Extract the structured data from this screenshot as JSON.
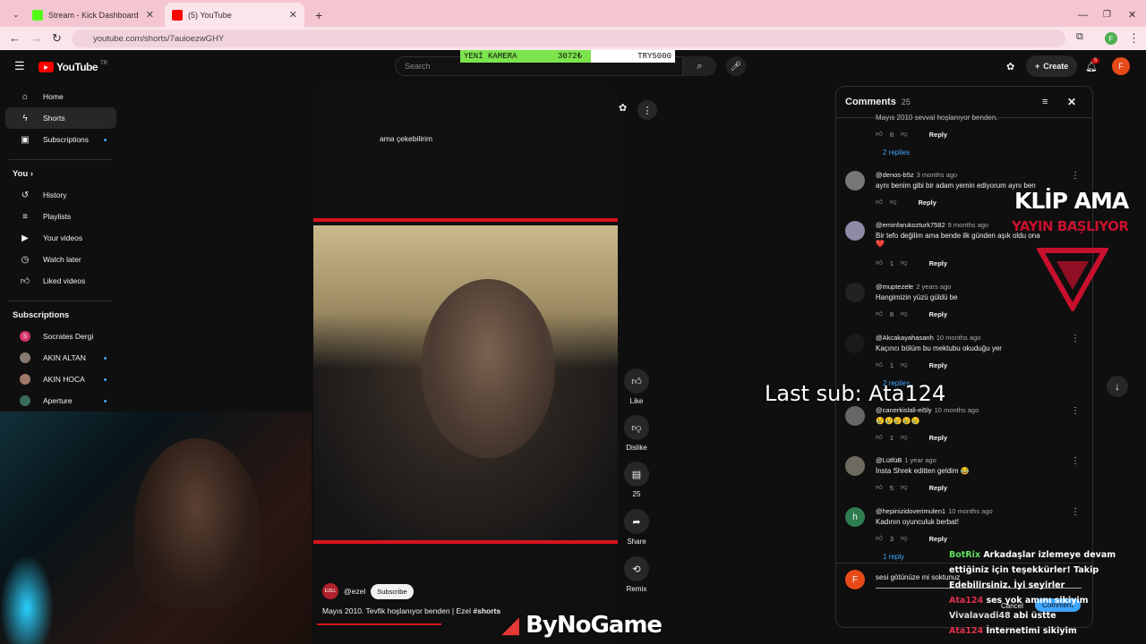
{
  "browser": {
    "tabs": [
      {
        "title": "Stream - Kick Dashboard",
        "favicon_color": "#53fc18"
      },
      {
        "title": "(5) YouTube",
        "favicon_color": "#ff0000"
      }
    ],
    "url": "youtube.com/shorts/7auioezwGHY",
    "new_tab_symbol": "+",
    "profile_initial": "F"
  },
  "youtube": {
    "logo_text": "YouTube",
    "logo_region": "TR",
    "search_placeholder": "Search",
    "create_label": "Create",
    "notifications_count": "5",
    "avatar_initial": "F"
  },
  "stream_overlay": {
    "camera_label": "YENİ KAMERA",
    "camera_amount": "3072₺",
    "target": "TRY5000",
    "last_sub": "Last sub: Ata124",
    "promo_line1": "KLİP AMA",
    "promo_line2": "YAYIN BAŞLIYOR",
    "watermark": "ByNoGame"
  },
  "sidebar": {
    "main": [
      {
        "label": "Home",
        "icon": "home-icon"
      },
      {
        "label": "Shorts",
        "icon": "shorts-icon",
        "selected": true
      },
      {
        "label": "Subscriptions",
        "icon": "subscriptions-icon"
      }
    ],
    "you_heading": "You",
    "you_items": [
      {
        "label": "History",
        "icon": "history-icon"
      },
      {
        "label": "Playlists",
        "icon": "playlists-icon"
      },
      {
        "label": "Your videos",
        "icon": "your-videos-icon"
      },
      {
        "label": "Watch later",
        "icon": "watch-later-icon"
      },
      {
        "label": "Liked videos",
        "icon": "liked-icon"
      }
    ],
    "subs_heading": "Subscriptions",
    "subs": [
      {
        "label": "Socrates Dergi",
        "color": "#d6336c"
      },
      {
        "label": "AKIN ALTAN",
        "color": "#8a7a70"
      },
      {
        "label": "AKIN HOCA",
        "color": "#a07868"
      },
      {
        "label": "Aperture",
        "color": "#3a6a5a"
      }
    ]
  },
  "video": {
    "caption": "ama çekebilirim",
    "channel": "@ezel",
    "channel_badge": "EZEL",
    "subscribe": "Subscribe",
    "title": "Mayıs 2010. Tevfik hoşlanıyor benden | Ezel ",
    "hashtag": "#shorts",
    "progress": 0.41
  },
  "actions": {
    "like": "Like",
    "dislike": "Dislike",
    "comments": "25",
    "share": "Share",
    "remix": "Remix"
  },
  "comments": {
    "title": "Comments",
    "count": "25",
    "reply_label": "Reply",
    "items": [
      {
        "user": "",
        "when": "",
        "text": "Mayıs 2010 sevval hoşlanıyor benden.",
        "likes": "8",
        "replies": "2 replies"
      },
      {
        "user": "@denos-b5z",
        "when": "3 months ago",
        "text": "aynı benim gibi bir adam yemin ediyorum aynı ben",
        "likes": "",
        "replies": ""
      },
      {
        "user": "@eminfarukozturk7582",
        "when": "9 months ago",
        "text": "Bir tefo değilim ama bende ilk günden aşık oldu ona",
        "extra": "❤️",
        "likes": "1",
        "replies": ""
      },
      {
        "user": "@muptezele",
        "when": "2 years ago",
        "text": "Hangimizin yüzü güldü be",
        "likes": "8",
        "replies": ""
      },
      {
        "user": "@Akcakayahasanh",
        "when": "10 months ago",
        "text": "Kaçıncı bölüm bu mektubu okuduğu yer",
        "likes": "1",
        "replies": "2 replies"
      },
      {
        "user": "@canerkislali-ei5ly",
        "when": "10 months ago",
        "text": "😢😢😢😢😢",
        "likes": "1",
        "replies": ""
      },
      {
        "user": "@LütfüB",
        "when": "1 year ago",
        "text": "İnsta Shrek editten geldim 😂",
        "likes": "5",
        "replies": ""
      },
      {
        "user": "@hepinizidoverimulen1",
        "when": "10 months ago",
        "text": "Kadının oyunculuk berbat!",
        "likes": "3",
        "replies": "1 reply"
      }
    ],
    "compose_text": "sesi götünüze mi soktunuz",
    "cancel": "Cancel",
    "submit": "Comment"
  },
  "chat": [
    {
      "user": "BotRix",
      "text": "Arkadaşlar izlemeye devam ettiğiniz için teşekkürler! Takip Edebilirsiniz. İyi seyirler"
    },
    {
      "user": "Ata124",
      "text": "ses yok amını sikiyim"
    },
    {
      "user": "Vivalavadi48",
      "text": "abi üstte"
    },
    {
      "user": "Ata124",
      "text": "İnternetimi sikiyim"
    }
  ]
}
